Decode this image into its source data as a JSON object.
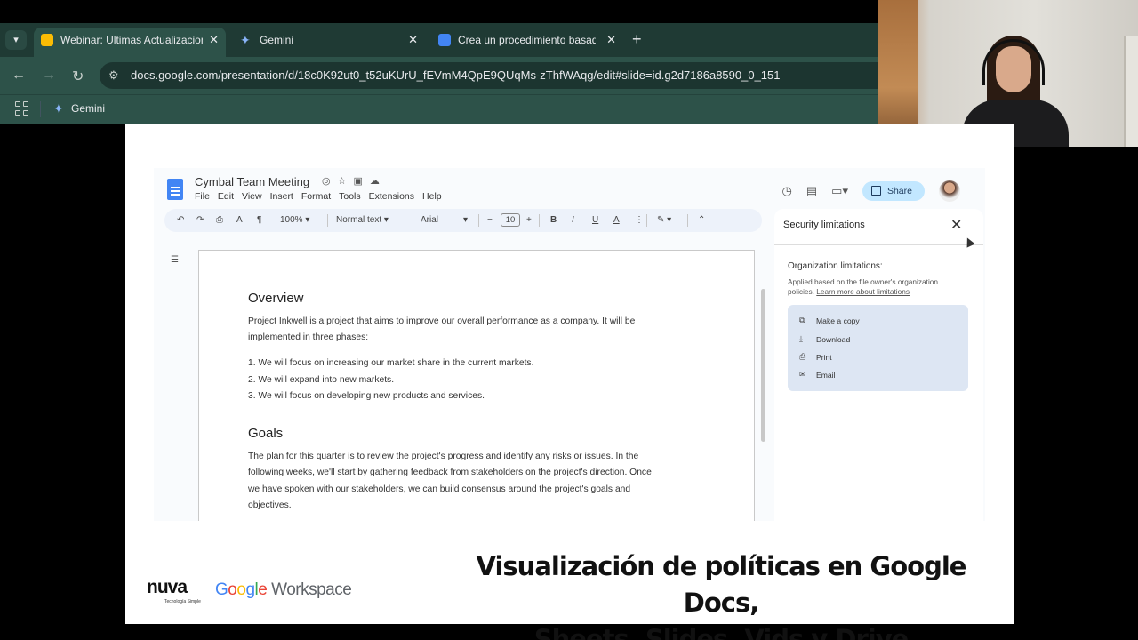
{
  "browser": {
    "tabs": [
      {
        "title": "Webinar: Ultimas Actualizaciones",
        "favicon_color": "#fbbc04",
        "active": true
      },
      {
        "title": "Gemini",
        "favicon_color": "#8ab4f8",
        "active": false
      },
      {
        "title": "Crea un procedimiento basado",
        "favicon_color": "#4285f4",
        "active": false
      }
    ],
    "url": "docs.google.com/presentation/d/18c0K92ut0_t52uKUrU_fEVmM4QpE9QUqMs-zThfWAqg/edit#slide=id.g2d7186a8590_0_151",
    "bookmark": "Gemini"
  },
  "docs": {
    "title": "Cymbal Team Meeting",
    "menu": [
      "File",
      "Edit",
      "View",
      "Insert",
      "Format",
      "Tools",
      "Extensions",
      "Help"
    ],
    "share_label": "Share",
    "toolbar": {
      "zoom": "100%",
      "style": "Normal text",
      "font": "Arial",
      "font_size": "10"
    },
    "document": {
      "heading1": "Overview",
      "para1": "Project Inkwell is a project that aims to improve our overall performance as a company. It will be implemented in three phases:",
      "list": [
        "1.  We will focus on increasing our market share in the current markets.",
        "2.  We will expand into new markets.",
        "3.  We will focus on developing new products and services."
      ],
      "heading2": "Goals",
      "para2": "The plan for this quarter is to review the project's progress and identify any risks or issues. In the following weeks, we'll start by gathering feedback from stakeholders on the project's direction. Once we have spoken with our stakeholders, we can build consensus around the project's goals and objectives."
    },
    "panel": {
      "title": "Security limitations",
      "org_title": "Organization limitations:",
      "org_desc": "Applied based on the file owner's organization policies.",
      "org_link": "Learn more about limitations",
      "limits": [
        "Make a copy",
        "Download",
        "Print",
        "Email"
      ]
    }
  },
  "footer": {
    "nuva": "nuva",
    "nuva_sub": "Tecnología Simple",
    "gw_google": [
      "G",
      "o",
      "o",
      "g",
      "l",
      "e"
    ],
    "gw_workspace": "Workspace",
    "caption_line1": "Visualización de políticas en Google Docs,",
    "caption_line2": "Sheets, Slides, Vids y Drive"
  }
}
